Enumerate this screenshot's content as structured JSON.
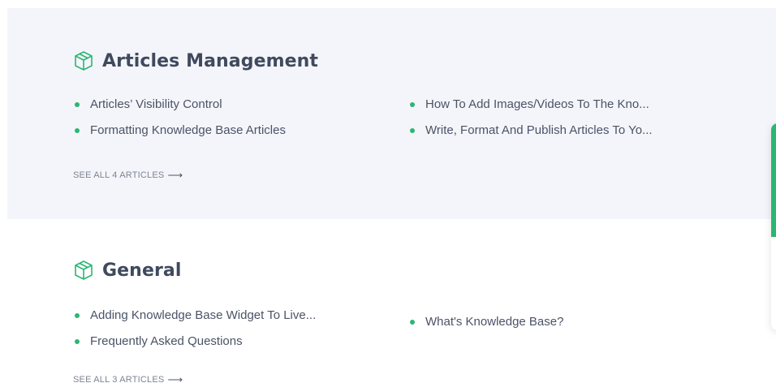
{
  "sections": [
    {
      "title": "Articles Management",
      "articles": [
        "Articles’ Visibility Control",
        "Formatting Knowledge Base Articles",
        "How To Add Images/Videos To The Kno...",
        "Write, Format And Publish Articles To Yo..."
      ],
      "see_all": "SEE ALL 4 ARTICLES"
    },
    {
      "title": "General",
      "articles": [
        "Adding Knowledge Base Widget To Live...",
        "Frequently Asked Questions",
        "What's Knowledge Base?"
      ],
      "see_all": "SEE ALL 3 ARTICLES"
    }
  ],
  "icons": {
    "category": "cube-icon",
    "see_all_arrow": "arrow-right-icon"
  },
  "colors": {
    "accent": "#2bb673",
    "shaded_bg": "#f4f5fa",
    "title": "#404a5e"
  }
}
